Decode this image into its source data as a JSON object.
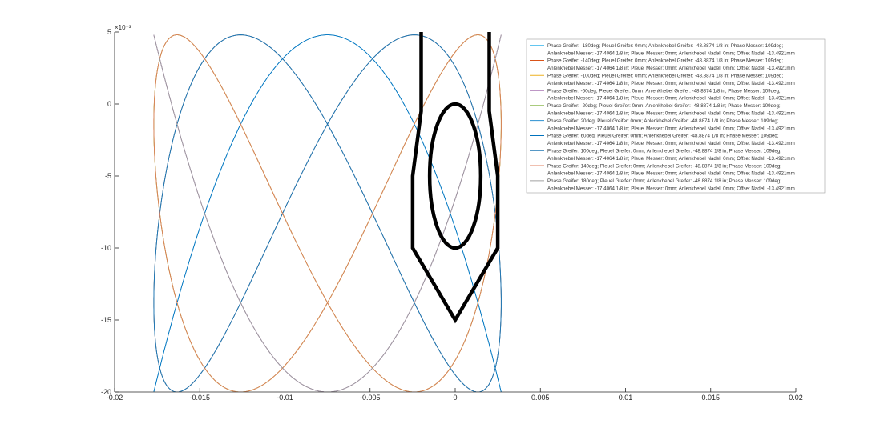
{
  "chart_data": {
    "type": "line",
    "title": "",
    "xlabel": "",
    "ylabel": "",
    "xlim": [
      -0.02,
      0.02
    ],
    "ylim": [
      -20,
      5
    ],
    "y_exponent_label": "×10⁻³",
    "xticks": [
      -0.02,
      -0.015,
      -0.01,
      -0.005,
      0,
      0.005,
      0.01,
      0.015,
      0.02
    ],
    "xtick_labels": [
      "-0.02",
      "-0.015",
      "-0.01",
      "-0.005",
      "0",
      "0.005",
      "0.01",
      "0.015",
      "0.02"
    ],
    "yticks": [
      5,
      0,
      -5,
      -10,
      -15,
      -20
    ],
    "ytick_labels": [
      "5",
      "0",
      "-5",
      "-10",
      "-15",
      "-20"
    ],
    "grid": false,
    "legend_position": "top-right",
    "series": [
      {
        "name": "Phase Greifer: -180deg; Pleuel Greifer: 0mm; Anlenkhebel Greifer: -48.8874 1/8 in; Phase Messer: 109deg; Anlenkhebel Messer: -17.4064 1/8 in; Pleuel Messer: 0mm; Anlenkhebel Nadel: 0mm; Offset Nadel: -13.4921mm",
        "legend_lines": [
          "Phase Greifer: -180deg; Pleuel Greifer: 0mm; Anlenkhebel Greifer: -48.8874 1/8 in; Phase Messer: 109deg;",
          "Anlenkhebel Messer: -17.4064 1/8 in; Pleuel Messer: 0mm; Anlenkhebel Nadel: 0mm; Offset Nadel: -13.4921mm"
        ],
        "color": "#4dbeee",
        "phase_deg": -180
      },
      {
        "name": "Phase Greifer: -140deg; Pleuel Greifer: 0mm; Anlenkhebel Greifer: -48.8874 1/8 in; Phase Messer: 109deg; Anlenkhebel Messer: -17.4064 1/8 in; Pleuel Messer: 0mm; Anlenkhebel Nadel: 0mm; Offset Nadel: -13.4921mm",
        "legend_lines": [
          "Phase Greifer: -140deg; Pleuel Greifer: 0mm; Anlenkhebel Greifer: -48.8874 1/8 in; Phase Messer: 109deg;",
          "Anlenkhebel Messer: -17.4064 1/8 in; Pleuel Messer: 0mm; Anlenkhebel Nadel: 0mm; Offset Nadel: -13.4921mm"
        ],
        "color": "#d95319",
        "phase_deg": -140
      },
      {
        "name": "Phase Greifer: -100deg; Pleuel Greifer: 0mm; Anlenkhebel Greifer: -48.8874 1/8 in; Phase Messer: 109deg; Anlenkhebel Messer: -17.4064 1/8 in; Pleuel Messer: 0mm; Anlenkhebel Nadel: 0mm; Offset Nadel: -13.4921mm",
        "legend_lines": [
          "Phase Greifer: -100deg; Pleuel Greifer: 0mm; Anlenkhebel Greifer: -48.8874 1/8 in; Phase Messer: 109deg;",
          "Anlenkhebel Messer: -17.4064 1/8 in; Pleuel Messer: 0mm; Anlenkhebel Nadel: 0mm; Offset Nadel: -13.4921mm"
        ],
        "color": "#edb120",
        "phase_deg": -100
      },
      {
        "name": "Phase Greifer: -60deg; Pleuel Greifer: 0mm; Anlenkhebel Greifer: -48.8874 1/8 in; Phase Messer: 109deg; Anlenkhebel Messer: -17.4064 1/8 in; Pleuel Messer: 0mm; Anlenkhebel Nadel: 0mm; Offset Nadel: -13.4921mm",
        "legend_lines": [
          "Phase Greifer: -60deg; Pleuel Greifer: 0mm; Anlenkhebel Greifer: -48.8874 1/8 in; Phase Messer: 109deg;",
          "Anlenkhebel Messer: -17.4064 1/8 in; Pleuel Messer: 0mm; Anlenkhebel Nadel: 0mm; Offset Nadel: -13.4921mm"
        ],
        "color": "#7e2f8e",
        "phase_deg": -60
      },
      {
        "name": "Phase Greifer: -20deg; Pleuel Greifer: 0mm; Anlenkhebel Greifer: -48.8874 1/8 in; Phase Messer: 109deg; Anlenkhebel Messer: -17.4064 1/8 in; Pleuel Messer: 0mm; Anlenkhebel Nadel: 0mm; Offset Nadel: -13.4921mm",
        "legend_lines": [
          "Phase Greifer: -20deg; Pleuel Greifer: 0mm; Anlenkhebel Greifer: -48.8874 1/8 in; Phase Messer: 109deg;",
          "Anlenkhebel Messer: -17.4064 1/8 in; Pleuel Messer: 0mm; Anlenkhebel Nadel: 0mm; Offset Nadel: -13.4921mm"
        ],
        "color": "#77ac30",
        "phase_deg": -20
      },
      {
        "name": "Phase Greifer: 20deg; Pleuel Greifer: 0mm; Anlenkhebel Greifer: -48.8874 1/8 in; Phase Messer: 109deg; Anlenkhebel Messer: -17.4064 1/8 in; Pleuel Messer: 0mm; Anlenkhebel Nadel: 0mm; Offset Nadel: -13.4921mm",
        "legend_lines": [
          "Phase Greifer: 20deg; Pleuel Greifer: 0mm; Anlenkhebel Greifer: -48.8874 1/8 in; Phase Messer: 109deg;",
          "Anlenkhebel Messer: -17.4064 1/8 in; Pleuel Messer: 0mm; Anlenkhebel Nadel: 0mm; Offset Nadel: -13.4921mm"
        ],
        "color": "#2a8fd0",
        "phase_deg": 20
      },
      {
        "name": "Phase Greifer: 60deg; Pleuel Greifer: 0mm; Anlenkhebel Greifer: -48.8874 1/8 in; Phase Messer: 109deg; Anlenkhebel Messer: -17.4064 1/8 in; Pleuel Messer: 0mm; Anlenkhebel Nadel: 0mm; Offset Nadel: -13.4921mm",
        "legend_lines": [
          "Phase Greifer: 60deg; Pleuel Greifer: 0mm; Anlenkhebel Greifer: -48.8874 1/8 in; Phase Messer: 109deg;",
          "Anlenkhebel Messer: -17.4064 1/8 in; Pleuel Messer: 0mm; Anlenkhebel Nadel: 0mm; Offset Nadel: -13.4921mm"
        ],
        "color": "#0072bd",
        "phase_deg": 60
      },
      {
        "name": "Phase Greifer: 100deg; Pleuel Greifer: 0mm; Anlenkhebel Greifer: -48.8874 1/8 in; Phase Messer: 109deg; Anlenkhebel Messer: -17.4064 1/8 in; Pleuel Messer: 0mm; Anlenkhebel Nadel: 0mm; Offset Nadel: -13.4921mm",
        "legend_lines": [
          "Phase Greifer: 100deg; Pleuel Greifer: 0mm; Anlenkhebel Greifer: -48.8874 1/8 in; Phase Messer: 109deg;",
          "Anlenkhebel Messer: -17.4064 1/8 in; Pleuel Messer: 0mm; Anlenkhebel Nadel: 0mm; Offset Nadel: -13.4921mm"
        ],
        "color": "#1f77b4",
        "phase_deg": 100
      },
      {
        "name": "Phase Greifer: 140deg; Pleuel Greifer: 0mm; Anlenkhebel Greifer: -48.8874 1/8 in; Phase Messer: 109deg; Anlenkhebel Messer: -17.4064 1/8 in; Pleuel Messer: 0mm; Anlenkhebel Nadel: 0mm; Offset Nadel: -13.4921mm",
        "legend_lines": [
          "Phase Greifer: 140deg; Pleuel Greifer: 0mm; Anlenkhebel Greifer: -48.8874 1/8 in; Phase Messer: 109deg;",
          "Anlenkhebel Messer: -17.4064 1/8 in; Pleuel Messer: 0mm; Anlenkhebel Nadel: 0mm; Offset Nadel: -13.4921mm"
        ],
        "color": "#e08060",
        "phase_deg": 140
      },
      {
        "name": "Phase Greifer: 180deg; Pleuel Greifer: 0mm; Anlenkhebel Greifer: -48.8874 1/8 in; Phase Messer: 109deg; Anlenkhebel Messer: -17.4064 1/8 in; Pleuel Messer: 0mm; Anlenkhebel Nadel: 0mm; Offset Nadel: -13.4921mm",
        "legend_lines": [
          "Phase Greifer: 180deg; Pleuel Greifer: 0mm; Anlenkhebel Greifer: -48.8874 1/8 in; Phase Messer: 109deg;",
          "Anlenkhebel Messer: -17.4064 1/8 in; Pleuel Messer: 0mm; Anlenkhebel Nadel: 0mm; Offset Nadel: -13.4921mm"
        ],
        "color": "#a0a0a0",
        "phase_deg": 180
      }
    ],
    "overlay": {
      "needle_outline_color": "#000000",
      "needle_outline": [
        [
          -0.002,
          5
        ],
        [
          -0.002,
          -0.5
        ],
        [
          -0.0025,
          -5
        ],
        [
          -0.0025,
          -10
        ],
        [
          0,
          -15
        ],
        [
          0.0025,
          -10
        ],
        [
          0.0025,
          -5
        ],
        [
          0.002,
          -0.5
        ],
        [
          0.002,
          5
        ]
      ],
      "needle_eye": {
        "cx": 0,
        "cy": -5,
        "rx": 0.0015,
        "ry": 5
      }
    }
  }
}
